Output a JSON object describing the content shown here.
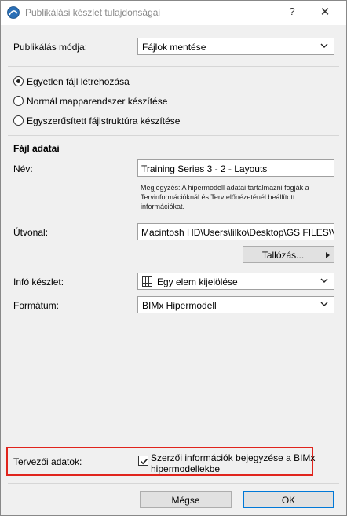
{
  "window": {
    "title": "Publikálási készlet tulajdonságai",
    "help_label": "?",
    "close_label": "✕"
  },
  "publish_mode": {
    "label": "Publikálás módja:",
    "value": "Fájlok mentése"
  },
  "structure_options": [
    {
      "label": "Egyetlen fájl létrehozása",
      "selected": true
    },
    {
      "label": "Normál mapparendszer készítése",
      "selected": false
    },
    {
      "label": "Egyszerűsített fájlstruktúra készítése",
      "selected": false
    }
  ],
  "file_data": {
    "heading": "Fájl adatai",
    "name_label": "Név:",
    "name_value": "Training Series 3 - 2 - Layouts",
    "note_lines": [
      "Megjegyzés: A hipermodell adatai tartalmazni fogják a",
      "Tervinformációknál és Terv előnézeténél beállított",
      "információkat."
    ],
    "path_label": "Útvonal:",
    "path_value": "Macintosh HD\\Users\\lilko\\Desktop\\GS FILES\\VC",
    "browse_label": "Tallózás..."
  },
  "info_set": {
    "label": "Infó készlet:",
    "value": "Egy elem kijelölése",
    "icon": "grid-icon"
  },
  "format": {
    "label": "Formátum:",
    "value": "BIMx Hipermodell"
  },
  "designer_data": {
    "label": "Tervezői adatok:",
    "checkbox_checked": true,
    "checkbox_line1": "Szerzői információk bejegyzése a BIMx",
    "checkbox_line2": "hipermodellekbe"
  },
  "buttons": {
    "cancel": "Mégse",
    "ok": "OK"
  },
  "colors": {
    "highlight": "#e0241c",
    "default_button_border": "#0078d7"
  }
}
